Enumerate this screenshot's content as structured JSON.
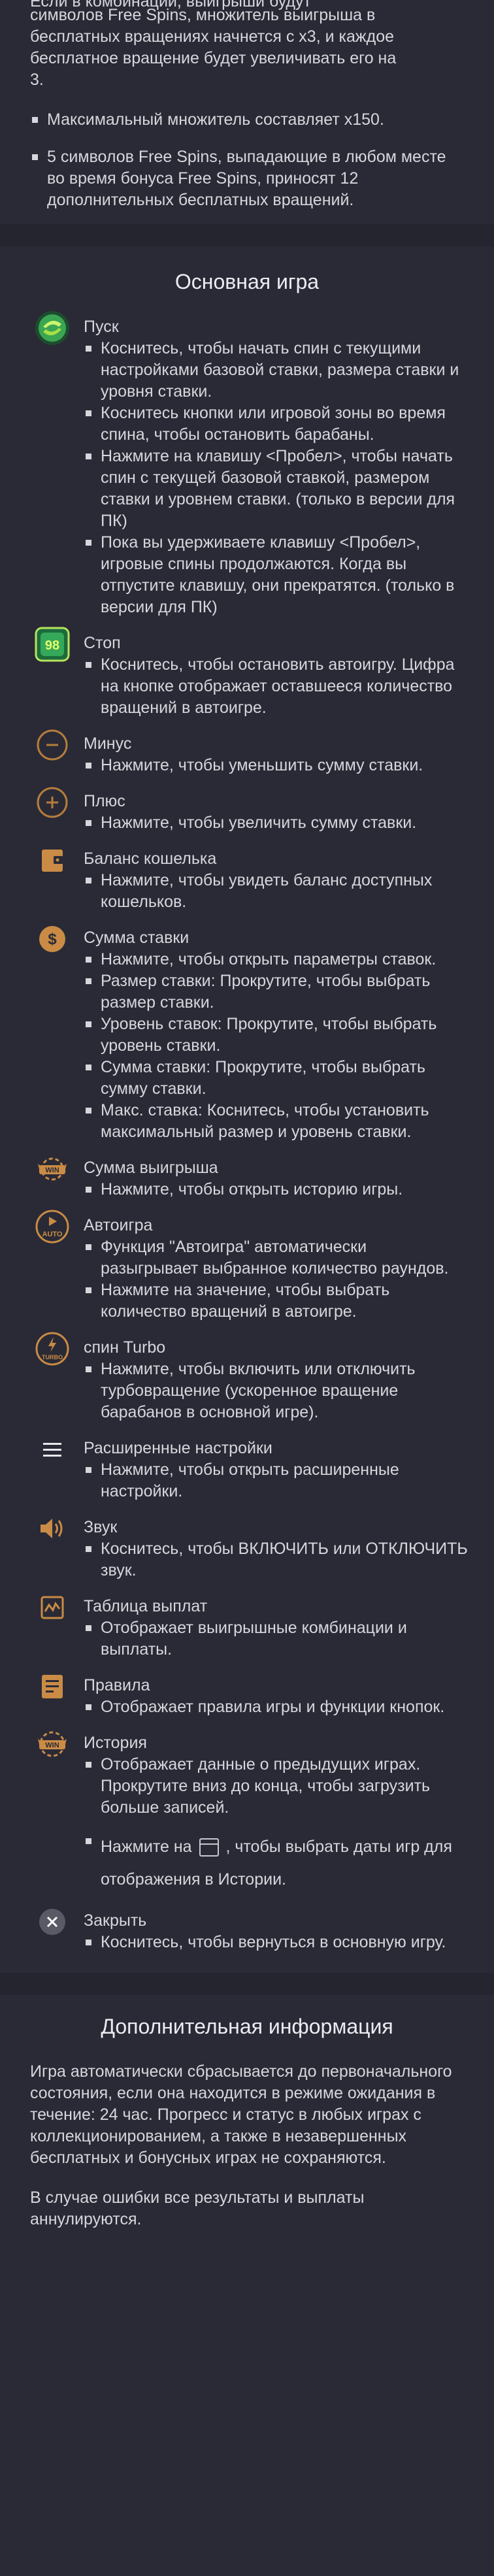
{
  "top": {
    "partial_lines": [
      "Если в комбинации, выигрыши будут",
      "символов Free Spins, множитель выигрыша в",
      "бесплатных вращениях начнется с x3, и каждое",
      "бесплатное вращение будет увеличивать его на",
      "3."
    ],
    "bullets": [
      "Максимальный множитель составляет x150.",
      "5 символов Free Spins, выпадающие в любом месте во время бонуса Free Spins, приносят 12 дополнительных бесплатных вращений."
    ]
  },
  "main_game": {
    "title": "Основная игра",
    "items": [
      {
        "name": "spin",
        "title": "Пуск",
        "icon": "spin-icon",
        "bullets": [
          "Коснитесь, чтобы начать спин с текущими настройками базовой ставки, размера ставки и уровня ставки.",
          "Коснитесь кнопки или игровой зоны во время спина, чтобы остановить барабаны.",
          "Нажмите на клавишу <Пробел>, чтобы начать спин с текущей базовой ставкой, размером ставки и уровнем ставки. (только в версии для ПК)",
          "Пока вы удерживаете клавишу <Пробел>, игровые спины продолжаются. Когда вы отпустите клавишу, они прекратятся. (только в версии для ПК)"
        ]
      },
      {
        "name": "stop",
        "title": "Стоп",
        "icon": "stop-icon",
        "badge": "98",
        "bullets": [
          "Коснитесь, чтобы остановить автоигру. Цифра на кнопке отображает оставшееся количество вращений в автоигре."
        ]
      },
      {
        "name": "minus",
        "title": "Минус",
        "icon": "minus-icon",
        "bullets": [
          "Нажмите, чтобы уменьшить сумму ставки."
        ]
      },
      {
        "name": "plus",
        "title": "Плюс",
        "icon": "plus-icon",
        "bullets": [
          "Нажмите, чтобы увеличить сумму ставки."
        ]
      },
      {
        "name": "wallet",
        "title": "Баланс кошелька",
        "icon": "wallet-icon",
        "bullets": [
          "Нажмите, чтобы увидеть баланс доступных кошельков."
        ]
      },
      {
        "name": "bet",
        "title": "Сумма ставки",
        "icon": "coins-icon",
        "bullets": [
          "Нажмите, чтобы открыть параметры ставок.",
          "Размер ставки: Прокрутите, чтобы выбрать размер ставки.",
          "Уровень ставок: Прокрутите, чтобы выбрать уровень ставки.",
          "Сумма ставки: Прокрутите, чтобы выбрать сумму ставки.",
          "Макс. ставка: Коснитесь, чтобы установить максимальный размер и уровень ставки."
        ]
      },
      {
        "name": "win",
        "title": "Сумма выигрыша",
        "icon": "win-icon",
        "badge": "WIN",
        "bullets": [
          "Нажмите, чтобы открыть историю игры."
        ]
      },
      {
        "name": "autoplay",
        "title": "Автоигра",
        "icon": "autoplay-icon",
        "badge": "AUTO",
        "bullets": [
          "Функция \"Автоигра\" автоматически разыгрывает выбранное количество раундов.",
          "Нажмите на значение, чтобы выбрать количество вращений в автоигре."
        ]
      },
      {
        "name": "turbo",
        "title": "спин Turbo",
        "icon": "turbo-icon",
        "badge": "TURBO",
        "bullets": [
          "Нажмите, чтобы включить или отключить турбовращение (ускоренное вращение барабанов в основной игре)."
        ]
      },
      {
        "name": "settings",
        "title": "Расширенные настройки",
        "icon": "menu-icon",
        "bullets": [
          "Нажмите, чтобы открыть расширенные настройки."
        ]
      },
      {
        "name": "sound",
        "title": "Звук",
        "icon": "sound-icon",
        "bullets": [
          "Коснитесь, чтобы ВКЛЮЧИТЬ или ОТКЛЮЧИТЬ звук."
        ]
      },
      {
        "name": "paytable",
        "title": "Таблица выплат",
        "icon": "paytable-icon",
        "bullets": [
          "Отображает выигрышные комбинации и выплаты."
        ]
      },
      {
        "name": "rules",
        "title": "Правила",
        "icon": "rules-icon",
        "bullets": [
          "Отображает правила игры и функции кнопок."
        ]
      },
      {
        "name": "history",
        "title": "История",
        "icon": "history-icon",
        "badge": "WIN",
        "bullets": [
          "Отображает данные о предыдущих играх. Прокрутите вниз до конца, чтобы загрузить больше записей."
        ],
        "calendar_before": "Нажмите на",
        "calendar_after": ", чтобы выбрать даты игр для отображения в Истории."
      },
      {
        "name": "close",
        "title": "Закрыть",
        "icon": "close-icon",
        "bullets": [
          "Коснитесь, чтобы вернуться в основную игру."
        ]
      }
    ]
  },
  "extra": {
    "title": "Дополнительная информация",
    "paragraphs": [
      "Игра автоматически сбрасывается до первоначального состояния, если она находится в режиме ожидания в течение: 24 час. Прогресс и статус в любых играх с коллекционированием, а также в незавершенных бесплатных и бонусных играх не сохраняются.",
      "В случае ошибки все результаты и выплаты аннулируются."
    ]
  },
  "colors": {
    "background": "#2a2a36",
    "accent": "#c98b45",
    "text": "#d6d6dc"
  }
}
